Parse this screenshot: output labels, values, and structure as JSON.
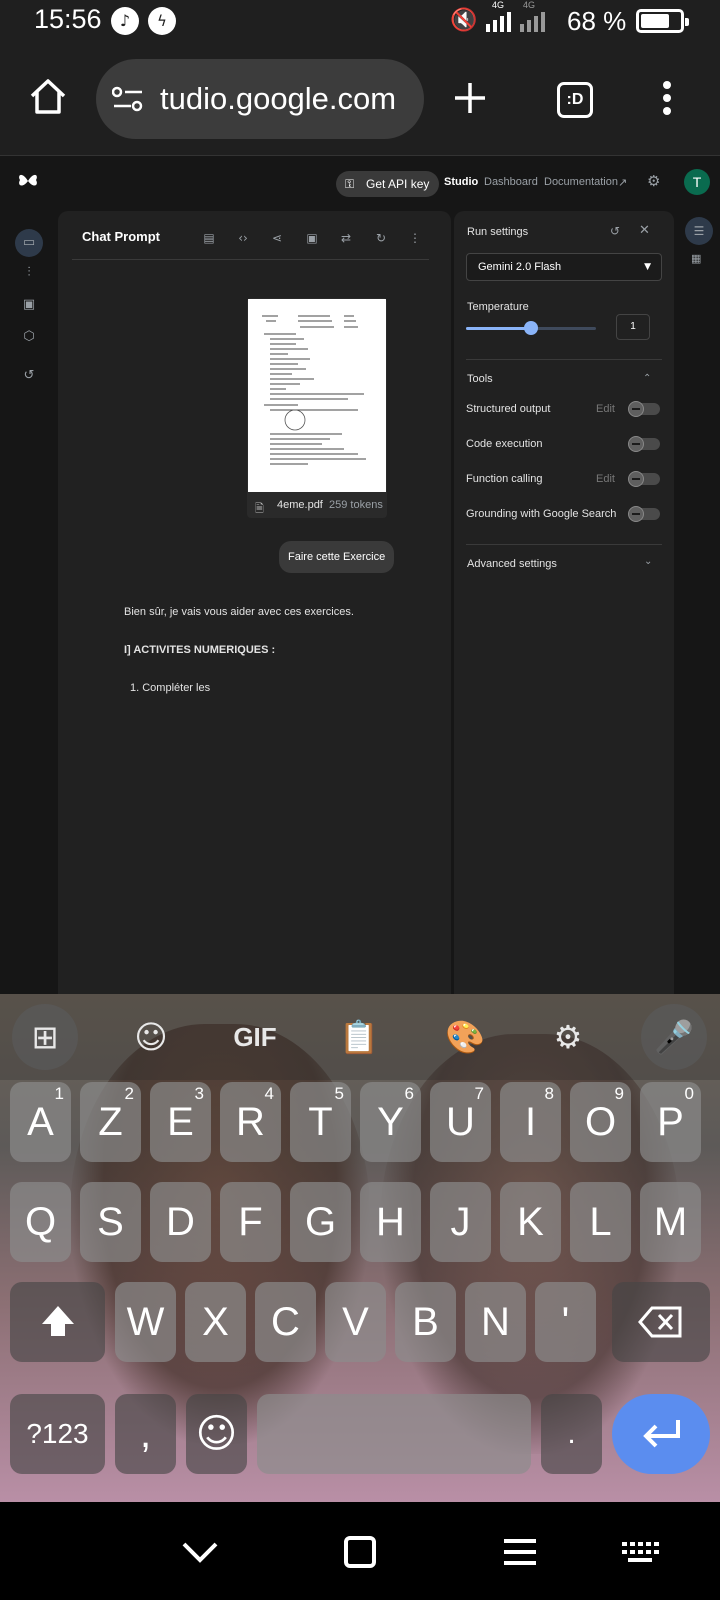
{
  "status_bar": {
    "time": "15:56",
    "network_1": "4G",
    "network_2": "4G",
    "battery": "68 %"
  },
  "browser": {
    "url": "tudio.google.com",
    "tab_count": ":D",
    "icons": [
      "home-icon",
      "site-settings-icon",
      "new-tab-icon",
      "tabs-icon",
      "menu-icon"
    ]
  },
  "studio_nav": {
    "api_key_button": "Get API key",
    "links": [
      "Studio",
      "Dashboard",
      "Documentation"
    ],
    "avatar": "T"
  },
  "chat": {
    "title": "Chat Prompt",
    "file": {
      "name": "4eme.pdf",
      "tokens": "259 tokens"
    },
    "user_message": "Faire cette Exercice",
    "response": {
      "intro": "Bien sûr, je vais vous aider avec ces exercices.",
      "heading": "I] ACTIVITES NUMERIQUES :",
      "item_1": "1. Compléter les"
    }
  },
  "run_settings": {
    "title": "Run settings",
    "model": "Gemini 2.0 Flash",
    "temperature_label": "Temperature",
    "temperature_value": "1",
    "temperature_fraction": 0.5,
    "tools_label": "Tools",
    "tools": [
      {
        "label": "Structured output",
        "edit": "Edit"
      },
      {
        "label": "Code execution",
        "edit": ""
      },
      {
        "label": "Function calling",
        "edit": "Edit"
      },
      {
        "label": "Grounding with Google Search",
        "edit": ""
      }
    ],
    "advanced_label": "Advanced settings"
  },
  "keyboard": {
    "toolbar": [
      "apps-icon",
      "sticker-icon",
      "GIF",
      "clipboard-icon",
      "palette-icon",
      "settings-icon",
      "mic-icon"
    ],
    "row1": [
      {
        "k": "A",
        "n": "1"
      },
      {
        "k": "Z",
        "n": "2"
      },
      {
        "k": "E",
        "n": "3"
      },
      {
        "k": "R",
        "n": "4"
      },
      {
        "k": "T",
        "n": "5"
      },
      {
        "k": "Y",
        "n": "6"
      },
      {
        "k": "U",
        "n": "7"
      },
      {
        "k": "I",
        "n": "8"
      },
      {
        "k": "O",
        "n": "9"
      },
      {
        "k": "P",
        "n": "0"
      }
    ],
    "row2": [
      "Q",
      "S",
      "D",
      "F",
      "G",
      "H",
      "J",
      "K",
      "L",
      "M"
    ],
    "row3": [
      "W",
      "X",
      "C",
      "V",
      "B",
      "N",
      "'"
    ],
    "symbols_key": "?123",
    "comma_key": ",",
    "period_key": "."
  }
}
